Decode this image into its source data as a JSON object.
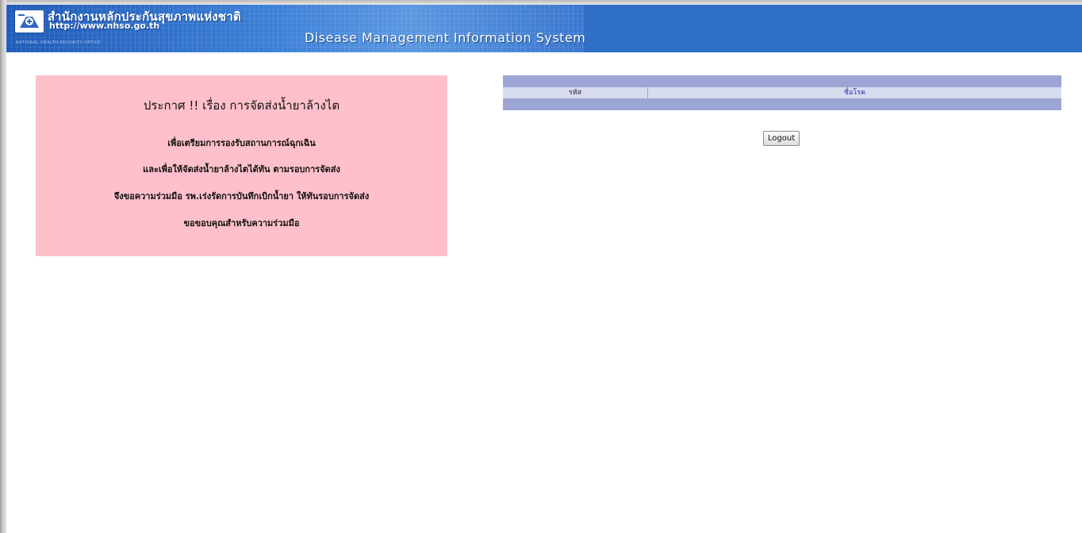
{
  "header": {
    "org_name_th": "สำนักงานหลักประกันสุขภาพแห่งชาติ",
    "org_url": "http://www.nhso.go.th",
    "org_name_en": "NATIONAL HEALTH SECURITY OFFICE",
    "system_name": "Disease Management Information System",
    "logo_icon": "nhso-logo-icon",
    "bg_color": "#3170c9"
  },
  "announcement": {
    "title": "ประกาศ !! เรื่อง การจัดส่งน้ำยาล้างไต",
    "lines": [
      "เพื่อเตรียมการรองรับสถานการณ์ฉุกเฉิน",
      "และเพื่อให้จัดส่งน้ำยาล้างไตได้ทัน ตามรอบการจัดส่ง",
      "จึงขอความร่วมมือ รพ.เร่งรัดการบันทึกเบิกน้ำยา ให้ทันรอบการจัดส่ง",
      "ขอขอบคุณสำหรับความร่วมมือ"
    ],
    "bg_color": "#ffc0cb"
  },
  "table": {
    "columns": [
      "รหัส",
      "ชื่อโรค"
    ],
    "rows": [],
    "header_color": "#9da5d4"
  },
  "actions": {
    "logout_label": "Logout"
  }
}
